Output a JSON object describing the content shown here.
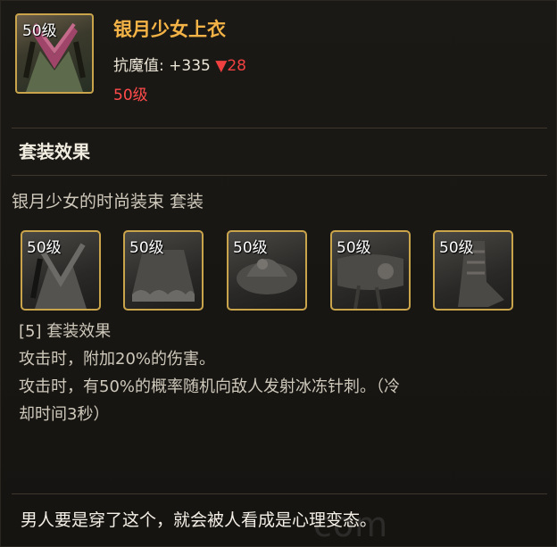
{
  "item": {
    "level_badge": "50级",
    "name": "银月少女上衣",
    "stat_label": "抗魔值:",
    "stat_value": "+335",
    "stat_change": "▼28",
    "required_level": "50级"
  },
  "set": {
    "section_title": "套装效果",
    "set_name": "银月少女的时尚装束 套装",
    "pieces": [
      {
        "level_badge": "50级"
      },
      {
        "level_badge": "50级"
      },
      {
        "level_badge": "50级"
      },
      {
        "level_badge": "50级"
      },
      {
        "level_badge": "50级"
      }
    ],
    "effect_header": "[5] 套装效果",
    "effect_lines": [
      "攻击时，附加20%的伤害。",
      "攻击时，有50%的概率随机向敌人发射冰冻针刺。（冷",
      "却时间3秒）"
    ]
  },
  "flavor_text": "男人要是穿了这个，就会被人看成是心理变态。",
  "watermark": "com",
  "colors": {
    "item_name": "#f3b346",
    "level_red": "#ff4b4b",
    "frame_gold": "#c9a44b"
  }
}
